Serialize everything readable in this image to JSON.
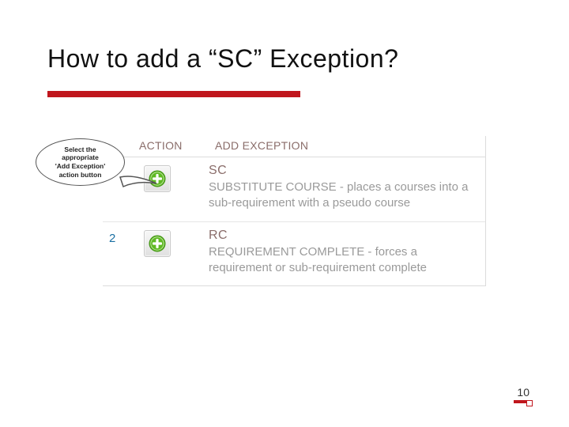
{
  "title": "How to add a “SC” Exception?",
  "callout": "Select the\nappropriate\n'Add Exception'\naction button",
  "headers": {
    "action": "ACTION",
    "exception": "ADD EXCEPTION"
  },
  "rows": [
    {
      "idx": "",
      "code": "SC",
      "desc": "SUBSTITUTE COURSE - places a courses into a sub-requirement with a pseudo course"
    },
    {
      "idx": "2",
      "code": "RC",
      "desc": "REQUIREMENT COMPLETE - forces a requirement or sub-requirement complete"
    }
  ],
  "page_number": "10"
}
